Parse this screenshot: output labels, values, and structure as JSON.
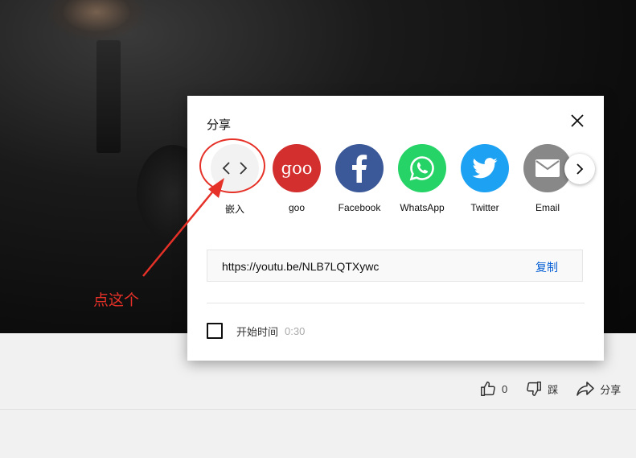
{
  "dialog": {
    "title": "分享",
    "share_items": [
      {
        "label": "嵌入",
        "icon": "embed-code-icon",
        "color": "#f2f2f2"
      },
      {
        "label": "goo",
        "icon": "goo-logo",
        "color": "#d32f2f",
        "logo_text": "goo"
      },
      {
        "label": "Facebook",
        "icon": "facebook-icon",
        "color": "#3b5998"
      },
      {
        "label": "WhatsApp",
        "icon": "whatsapp-icon",
        "color": "#25d366"
      },
      {
        "label": "Twitter",
        "icon": "twitter-icon",
        "color": "#1da1f2"
      },
      {
        "label": "Email",
        "icon": "email-icon",
        "color": "#888888"
      }
    ],
    "url": "https://youtu.be/NLB7LQTXywc",
    "copy_label": "复制",
    "start_at_label": "开始时间",
    "start_at_time": "0:30"
  },
  "actions": {
    "like_count": "0",
    "dislike_label": "踩",
    "share_label": "分享"
  },
  "annotation": {
    "text": "点这个",
    "color": "#e53127"
  }
}
